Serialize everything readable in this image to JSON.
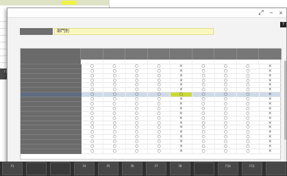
{
  "window": {
    "title": ""
  },
  "department": {
    "label": "",
    "value": "部門別"
  },
  "columns": [
    "",
    "",
    "",
    "",
    "",
    "",
    "",
    "",
    ""
  ],
  "rows": [
    {
      "label": "",
      "indent": 0,
      "values": [
        "",
        "",
        "",
        "",
        "",
        "",
        "",
        "",
        ""
      ]
    },
    {
      "label": "",
      "indent": 1,
      "values": [
        "○",
        "○",
        "○",
        "○",
        "×",
        "○",
        "○",
        "○",
        "×"
      ]
    },
    {
      "label": "",
      "indent": 2,
      "values": [
        "○",
        "○",
        "○",
        "○",
        "×",
        "○",
        "○",
        "○",
        "×"
      ]
    },
    {
      "label": "",
      "indent": 2,
      "values": [
        "○",
        "○",
        "○",
        "○",
        "×",
        "○",
        "○",
        "○",
        "×"
      ]
    },
    {
      "label": "",
      "indent": 2,
      "values": [
        "○",
        "○",
        "○",
        "○",
        "×",
        "○",
        "○",
        "○",
        "×"
      ]
    },
    {
      "label": "",
      "indent": 2,
      "values": [
        "○",
        "○",
        "○",
        "○",
        "×",
        "○",
        "○",
        "○",
        "×"
      ]
    },
    {
      "label": "",
      "indent": 2,
      "values": [
        "○",
        "○",
        "○",
        "○",
        "×",
        "○",
        "○",
        "○",
        "×"
      ]
    },
    {
      "label": "",
      "indent": 2,
      "values": [
        "○",
        "○",
        "○",
        "○",
        "○",
        "○",
        "○",
        "○",
        "×"
      ]
    },
    {
      "label": "",
      "indent": 2,
      "values": [
        "○",
        "○",
        "○",
        "○",
        "×",
        "○",
        "○",
        "○",
        "×"
      ]
    },
    {
      "label": "",
      "indent": 1,
      "values": [
        "○",
        "○",
        "○",
        "○",
        "×",
        "○",
        "○",
        "○",
        "×"
      ]
    },
    {
      "label": "",
      "indent": 1,
      "values": [
        "○",
        "○",
        "○",
        "○",
        "×",
        "○",
        "○",
        "○",
        "×"
      ]
    },
    {
      "label": "",
      "indent": 1,
      "values": [
        "○",
        "○",
        "○",
        "○",
        "×",
        "○",
        "○",
        "○",
        "×"
      ]
    },
    {
      "label": "",
      "indent": 1,
      "values": [
        "○",
        "○",
        "○",
        "○",
        "×",
        "○",
        "○",
        "○",
        "×"
      ]
    },
    {
      "label": "",
      "indent": 2,
      "values": [
        "○",
        "○",
        "○",
        "○",
        "×",
        "○",
        "○",
        "○",
        "×"
      ]
    },
    {
      "label": "",
      "indent": 2,
      "values": [
        "○",
        "○",
        "○",
        "○",
        "×",
        "○",
        "○",
        "○",
        "×"
      ]
    },
    {
      "label": "",
      "indent": 2,
      "values": [
        "○",
        "○",
        "○",
        "○",
        "×",
        "○",
        "○",
        "○",
        "×"
      ]
    },
    {
      "label": "",
      "indent": 2,
      "values": [
        "○",
        "○",
        "○",
        "○",
        "×",
        "○",
        "○",
        "○",
        "×"
      ]
    },
    {
      "label": "",
      "indent": 2,
      "values": [
        "○",
        "○",
        "○",
        "○",
        "×",
        "○",
        "○",
        "○",
        "×"
      ]
    },
    {
      "label": "",
      "indent": 2,
      "values": [
        "○",
        "○",
        "○",
        "○",
        "×",
        "○",
        "○",
        "○",
        "×"
      ]
    },
    {
      "label": "",
      "indent": 2,
      "values": [
        "○",
        "○",
        "○",
        "○",
        "×",
        "○",
        "○",
        "○",
        "×"
      ]
    }
  ],
  "selected_row": 7,
  "highlighted_cell": {
    "row": 7,
    "col": 4
  },
  "colors": {
    "highlight": "#c9d93a",
    "selected_row": "#cfdae9",
    "dept_field": "#fbf7c0"
  },
  "function_keys": [
    {
      "key": "F1",
      "label": "",
      "enabled": true
    },
    {
      "key": "",
      "label": "",
      "enabled": false
    },
    {
      "key": "",
      "label": "",
      "enabled": false
    },
    {
      "key": "F4",
      "label": "",
      "enabled": true
    },
    {
      "key": "F5",
      "label": "",
      "enabled": true
    },
    {
      "key": "F6",
      "label": "",
      "enabled": true
    },
    {
      "key": "F7",
      "label": "",
      "enabled": true
    },
    {
      "key": "F8",
      "label": "",
      "enabled": true
    },
    {
      "key": "",
      "label": "",
      "enabled": false
    },
    {
      "key": "F10",
      "label": "",
      "enabled": true
    },
    {
      "key": "F11",
      "label": "",
      "enabled": true
    },
    {
      "key": "",
      "label": "",
      "enabled": true
    }
  ],
  "background_window": {
    "fkey": {
      "key": "F1",
      "label": ""
    }
  }
}
